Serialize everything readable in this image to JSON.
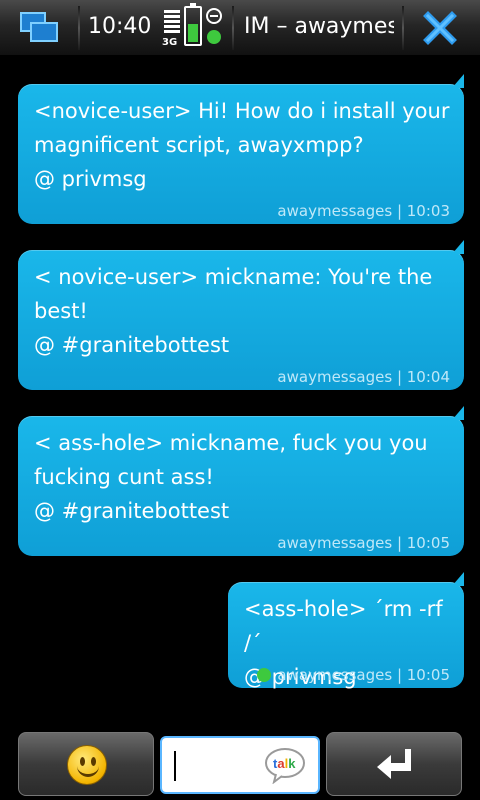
{
  "statusbar": {
    "time": "10:40",
    "network": "3G",
    "title": "IM – awaymes",
    "icons": [
      "task-switcher-icon",
      "signal-icon",
      "battery-icon",
      "presence-icon",
      "close-icon"
    ]
  },
  "messages": [
    {
      "lines": [
        "<novice-user> Hi! How do i install your",
        "magnificent script, awayxmpp?",
        "@ privmsg"
      ],
      "meta": "awaymessages | 10:03",
      "online_dot": false
    },
    {
      "lines": [
        "< novice-user> mickname: You're the",
        "best!",
        "@ #granitebottest"
      ],
      "meta": "awaymessages | 10:04",
      "online_dot": false
    },
    {
      "lines": [
        "< ass-hole> mickname, fuck you you",
        "fucking cunt ass!",
        "@ #granitebottest"
      ],
      "meta": "awaymessages | 10:05",
      "online_dot": false
    },
    {
      "lines": [
        "<ass-hole> ´rm -rf /´",
        "@ privmsg"
      ],
      "meta": "awaymessages | 10:05",
      "online_dot": true
    }
  ],
  "composer": {
    "value": "",
    "smiley_icon": "smiley-icon",
    "talk_icon": "talk-icon",
    "send_icon": "enter-icon"
  },
  "colors": {
    "bubble": "#12a9e0",
    "online": "#3ec93e",
    "accent": "#3399ff"
  }
}
